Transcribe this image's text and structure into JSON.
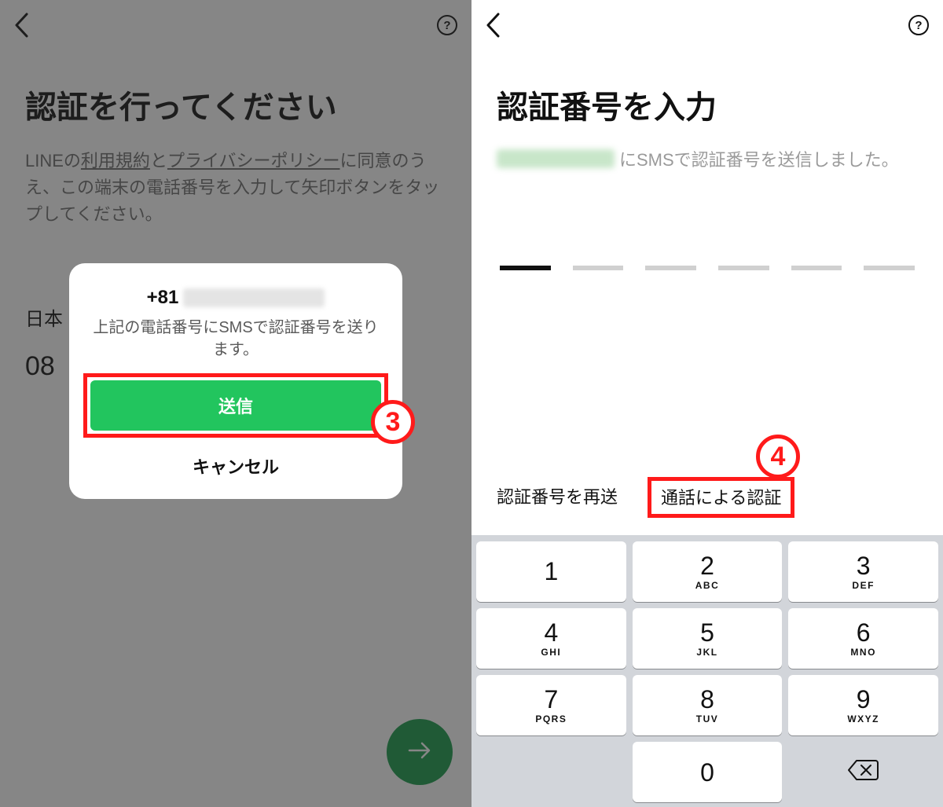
{
  "left": {
    "title": "認証を行ってください",
    "desc_pre": "LINEの",
    "terms_link": "利用規約",
    "desc_and": "と",
    "privacy_link": "プライバシーポリシー",
    "desc_post": "に同意のうえ、この端末の電話番号を入力して矢印ボタンをタップしてください。",
    "country_label": "日本",
    "phone_partial": "08",
    "modal": {
      "prefix": "+81",
      "sub": "上記の電話番号にSMSで認証番号を送ります。",
      "send": "送信",
      "cancel": "キャンセル"
    },
    "step_badge": "3"
  },
  "right": {
    "title": "認証番号を入力",
    "sent_suffix": "にSMSで認証番号を送信しました。",
    "code_digits": 6,
    "resend": "認証番号を再送",
    "call_auth": "通話による認証",
    "step_badge": "4",
    "keypad": [
      {
        "num": "1",
        "letters": ""
      },
      {
        "num": "2",
        "letters": "ABC"
      },
      {
        "num": "3",
        "letters": "DEF"
      },
      {
        "num": "4",
        "letters": "GHI"
      },
      {
        "num": "5",
        "letters": "JKL"
      },
      {
        "num": "6",
        "letters": "MNO"
      },
      {
        "num": "7",
        "letters": "PQRS"
      },
      {
        "num": "8",
        "letters": "TUV"
      },
      {
        "num": "9",
        "letters": "WXYZ"
      },
      {
        "num": "0",
        "letters": ""
      }
    ]
  }
}
